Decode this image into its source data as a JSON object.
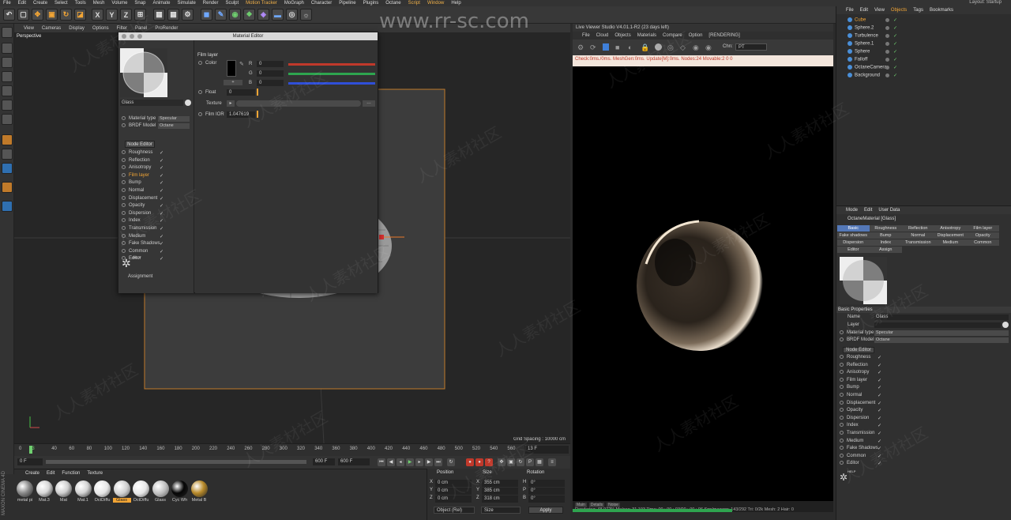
{
  "menubar": {
    "items": [
      "File",
      "Edit",
      "Create",
      "Select",
      "Tools",
      "Mesh",
      "Volume",
      "Snap",
      "Animate",
      "Simulate",
      "Render",
      "Sculpt",
      "Motion Tracker",
      "MoGraph",
      "Character",
      "Pipeline",
      "Plugins",
      "Octane",
      "Script",
      "Window",
      "Help"
    ],
    "highlighted": [
      "Motion Tracker",
      "Script",
      "Window"
    ],
    "layout_label": "Layout: ",
    "layout_value": "Startup"
  },
  "watermark_url": "www.rr-sc.com",
  "watermark_text": "人人素材社区",
  "viewport": {
    "menu": [
      "View",
      "Cameras",
      "Display",
      "Options",
      "Filter",
      "Panel",
      "ProRender"
    ],
    "label": "Perspective",
    "grid_spacing": "Grid Spacing : 10000 cm"
  },
  "timeline": {
    "ticks": [
      "0",
      "13",
      "40",
      "60",
      "80",
      "100",
      "120",
      "140",
      "160",
      "180",
      "200",
      "220",
      "240",
      "260",
      "280",
      "300",
      "320",
      "340",
      "360",
      "380",
      "400",
      "420",
      "440",
      "460",
      "480",
      "500",
      "520",
      "540",
      "560",
      "580",
      "600"
    ],
    "current_frame": "13 F",
    "start_field": "0 F",
    "end_field": "600 F",
    "end_field_b": "600 F"
  },
  "material_manager": {
    "menu": [
      "Create",
      "Edit",
      "Function",
      "Texture"
    ],
    "materials": [
      {
        "name": "metal pi",
        "color": "#8a8a8a"
      },
      {
        "name": "Mat.3",
        "color": "#d8d8d8"
      },
      {
        "name": "Mat",
        "color": "#d0d0d0"
      },
      {
        "name": "Mat.1",
        "color": "#d4d4d4"
      },
      {
        "name": "OctDiffu",
        "color": "#e6e6e6"
      },
      {
        "name": "Glass",
        "color": "#cfcfcf",
        "selected": true
      },
      {
        "name": "OctDiffu",
        "color": "#e6e6e6"
      },
      {
        "name": "Glass",
        "color": "#bdbdbd"
      },
      {
        "name": "Cyc Wh",
        "color": "#060606"
      },
      {
        "name": "Metal B",
        "color": "#b88a2a"
      }
    ],
    "brand": "MAXON CINEMA 4D"
  },
  "coordinates": {
    "headers": [
      "Position",
      "Size",
      "Rotation"
    ],
    "rows": [
      {
        "axis": "X",
        "pos": "0 cm",
        "size_axis": "X",
        "size": "355 cm",
        "rot_axis": "H",
        "rot": "0°"
      },
      {
        "axis": "Y",
        "pos": "0 cm",
        "size_axis": "Y",
        "size": "385 cm",
        "rot_axis": "P",
        "rot": "0°"
      },
      {
        "axis": "Z",
        "pos": "0 cm",
        "size_axis": "Z",
        "size": "318 cm",
        "rot_axis": "B",
        "rot": "0°"
      }
    ],
    "mode_object": "Object (Rel)",
    "mode_size": "Size",
    "apply": "Apply"
  },
  "material_editor": {
    "title": "Material Editor",
    "material_name": "Glass",
    "material_type_label": "Material type",
    "material_type_value": "Specular",
    "brdf_label": "BRDF Model",
    "brdf_value": "Octane",
    "node_editor": "Node Editor",
    "channels": [
      {
        "label": "Roughness",
        "checked": "✓"
      },
      {
        "label": "Reflection",
        "checked": "✓"
      },
      {
        "label": "Anisotropy",
        "checked": "✓"
      },
      {
        "label": "Film layer",
        "checked": "✓",
        "active": true
      },
      {
        "label": "Bump",
        "checked": "✓"
      },
      {
        "label": "Normal",
        "checked": "✓"
      },
      {
        "label": "Displacement",
        "checked": "✓"
      },
      {
        "label": "Opacity",
        "checked": "✓"
      },
      {
        "label": "Dispersion",
        "checked": "✓"
      },
      {
        "label": "Index",
        "checked": "✓"
      },
      {
        "label": "Transmission",
        "checked": "✓"
      },
      {
        "label": "Medium",
        "checked": "✓"
      },
      {
        "label": "Fake Shadows",
        "checked": "✓"
      },
      {
        "label": "Common",
        "checked": "✓"
      },
      {
        "label": "Editor",
        "checked": "✓"
      }
    ],
    "help": "HELP",
    "assignment": "Assignment",
    "section": "Film layer",
    "color_label": "Color",
    "r_label": "R",
    "r_value": "0",
    "g_label": "G",
    "g_value": "0",
    "b_label": "B",
    "b_value": "0",
    "float_label": "Float",
    "float_value": "0",
    "texture_label": "Texture",
    "film_ior_label": "Film IOR",
    "film_ior_value": "1.047619"
  },
  "render_viewer": {
    "title": "Live Viewer Studio V4.01.1-R2 (23 days left)",
    "menu": [
      "File",
      "Cloud",
      "Objects",
      "Materials",
      "Compare",
      "Option"
    ],
    "rendering": "[RENDERING]",
    "chn_label": "Chn:",
    "chn_value": "PT",
    "status": "Check:0ms./0ms. MeshGen:0ms. Update[M]:0ms. Nodes:24 Movable:2  0 0",
    "bottom_tabs": [
      "Main",
      "Details",
      "Noise"
    ],
    "stats": "Rendering: 48.972%  Ms/sec: 31.193   Time: 00 : 00 : 03/00 : 00 : 06        Spp/maxspp: 143/292     Tri: 0/2k     Mesh: 2  Hair: 0",
    "progress": 0.49
  },
  "object_manager": {
    "menu": [
      "File",
      "Edit",
      "View",
      "Objects",
      "Tags",
      "Bookmarks"
    ],
    "objects": [
      {
        "name": "Cube",
        "selected": true
      },
      {
        "name": "Sphere.2"
      },
      {
        "name": "Turbulence"
      },
      {
        "name": "Sphere.1"
      },
      {
        "name": "Sphere"
      },
      {
        "name": "Falloff"
      },
      {
        "name": "OctaneCamera"
      },
      {
        "name": "Background"
      }
    ]
  },
  "attribute_manager": {
    "menu": [
      "Mode",
      "Edit",
      "User Data"
    ],
    "header": "OctaneMaterial [Glass]",
    "tabs": [
      "Basic",
      "Roughness",
      "Reflection",
      "Anisotropy",
      "Film layer",
      "Fake shadows",
      "Bump",
      "Normal",
      "Displacement",
      "Opacity",
      "Dispersion",
      "Index",
      "Transmission",
      "Medium",
      "Common",
      "Editor",
      "Assign"
    ],
    "basic_props": "Basic Properties",
    "name_label": "Name",
    "name_value": "Glass",
    "layer_label": "Layer",
    "mat_type_label": "Material type",
    "mat_type_value": "Specular",
    "brdf_label": "BRDF Model",
    "brdf_value": "Octane",
    "node_editor": "Node Editor",
    "channels": [
      "Roughness",
      "Reflection",
      "Anisotropy",
      "Film layer",
      "Bump",
      "Normal",
      "Displacement",
      "Opacity",
      "Dispersion",
      "Index",
      "Transmission",
      "Medium",
      "Fake Shadows",
      "Common",
      "Editor"
    ],
    "check": "✓",
    "help": "HELP"
  }
}
